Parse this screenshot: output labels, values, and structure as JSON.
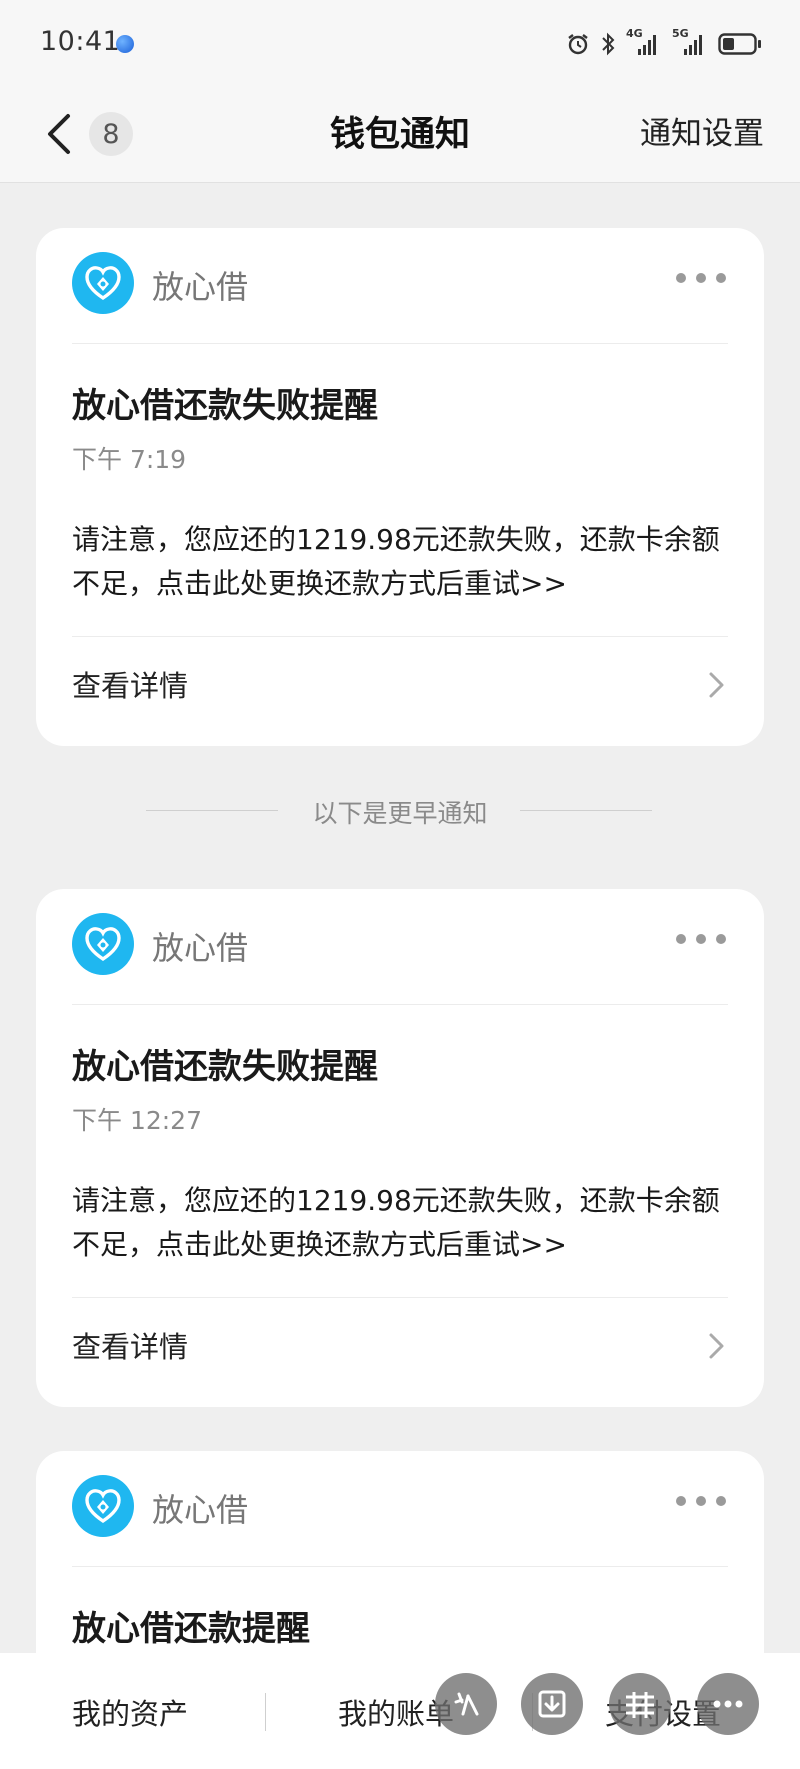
{
  "status_bar": {
    "time": "10:41",
    "network_1": "4G",
    "network_2": "5G"
  },
  "nav": {
    "count": "8",
    "title": "钱包通知",
    "action": "通知设置"
  },
  "notifications": [
    {
      "app_name": "放心借",
      "title": "放心借还款失败提醒",
      "time": "下午 7:19",
      "body": "请注意，您应还的1219.98元还款失败，还款卡余额不足，点击此处更换还款方式后重试>>",
      "detail_label": "查看详情"
    },
    {
      "app_name": "放心借",
      "title": "放心借还款失败提醒",
      "time": "下午 12:27",
      "body": "请注意，您应还的1219.98元还款失败，还款卡余额不足，点击此处更换还款方式后重试>>",
      "detail_label": "查看详情"
    },
    {
      "app_name": "放心借",
      "title": "放心借还款提醒"
    }
  ],
  "earlier_divider": "以下是更早通知",
  "bottom_bar": {
    "items": [
      "我的资产",
      "我的账单",
      "支付设置"
    ]
  },
  "colors": {
    "logo": "#1fb7f0",
    "background": "#efefef"
  }
}
